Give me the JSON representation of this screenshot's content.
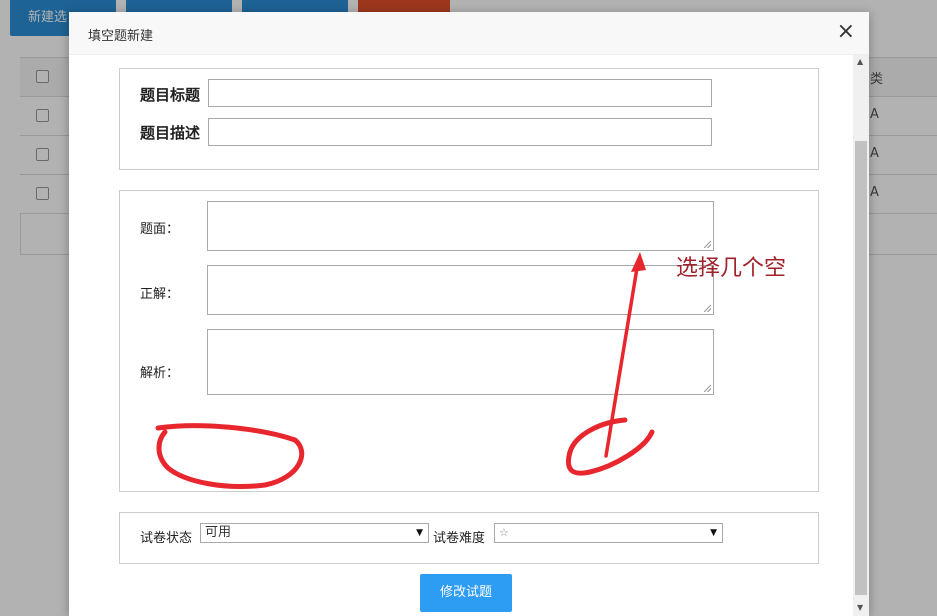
{
  "background": {
    "top_buttons": [
      {
        "label": "新建选",
        "color": "#2a8fd6"
      },
      {
        "label": "",
        "color": "#2a8fd6"
      },
      {
        "label": "",
        "color": "#2a8fd6"
      },
      {
        "label": "",
        "color": "#e0502a"
      }
    ],
    "table_cells": [
      "A",
      "A",
      "A"
    ],
    "header_fragment": "类"
  },
  "modal": {
    "title": "填空题新建",
    "close_icon": "×",
    "section1": {
      "title_label": "题目标题",
      "title_value": "",
      "desc_label": "题目描述",
      "desc_value": ""
    },
    "section2": {
      "stem_label": "题面：",
      "answer_label": "正解：",
      "analysis_label": "解析："
    },
    "section3": {
      "status_label": "试卷状态",
      "status_value": "可用",
      "difficulty_label": "试卷难度",
      "difficulty_value": "☆"
    },
    "submit_label": "修改试题"
  },
  "annotation": {
    "text": "选择几个空",
    "color": "#e8262d"
  }
}
